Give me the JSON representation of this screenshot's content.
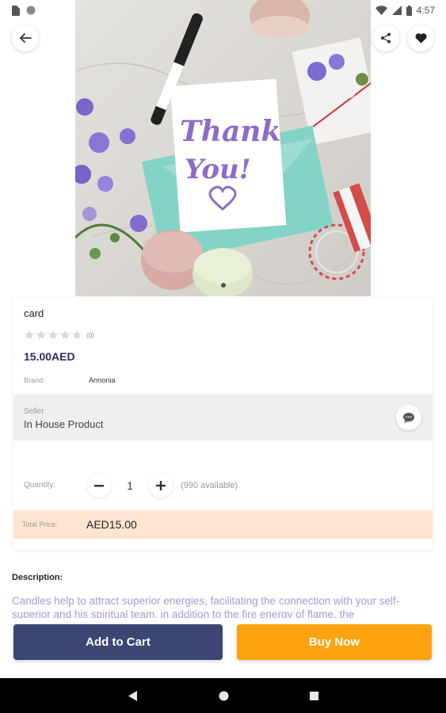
{
  "status_bar": {
    "time": "4:57"
  },
  "product": {
    "name": "card",
    "rating_count": "(0)",
    "price": "15.00AED",
    "brand_label": "Brand:",
    "brand_value": "Armonia",
    "stars": {
      "filled": 0,
      "total": 5
    }
  },
  "seller": {
    "label": "Seller",
    "value": "In House Product"
  },
  "quantity": {
    "label": "Quantity:",
    "value": "1",
    "available": "(990 available)"
  },
  "total": {
    "label": "Total Price:",
    "value": "AED15.00"
  },
  "description": {
    "title": "Description:",
    "text": "Candles help to attract superior energies, facilitating the connection with your self-superior and his spiritual team, in addition to the fire energy of flame, the"
  },
  "actions": {
    "add_to_cart": "Add to Cart",
    "buy_now": "Buy Now"
  },
  "colors": {
    "primary": "#3b4673",
    "accent": "#fca30f",
    "price_text": "#2b2b5e",
    "total_band": "#fde5cf",
    "description_text": "#a996d8"
  },
  "hero_image": {
    "card_text_line1": "Thank",
    "card_text_line2": "You!"
  },
  "icons": [
    "back-arrow-icon",
    "share-icon",
    "heart-icon",
    "chat-icon",
    "minus-icon",
    "plus-icon",
    "star-icon"
  ]
}
